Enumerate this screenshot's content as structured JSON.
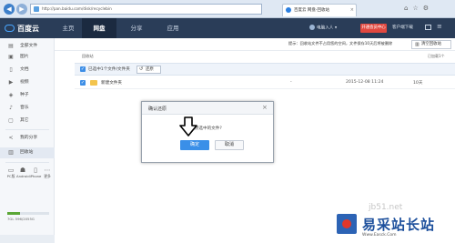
{
  "browser": {
    "url": "http://pan.baidu.com/disk/recyclebin",
    "tab_title": "百度云 网盘-回收站"
  },
  "header": {
    "logo": "百度云",
    "nav": [
      "主页",
      "网盘",
      "分享",
      "应用"
    ],
    "user": "电脑入人",
    "vip": "开通会员中心",
    "client": "客户端下载"
  },
  "sidebar": {
    "items": [
      {
        "label": "全部文件",
        "icon": "all-files-icon"
      },
      {
        "label": "图片",
        "icon": "image-icon"
      },
      {
        "label": "文档",
        "icon": "document-icon"
      },
      {
        "label": "视频",
        "icon": "video-icon"
      },
      {
        "label": "种子",
        "icon": "torrent-icon"
      },
      {
        "label": "音乐",
        "icon": "music-icon"
      },
      {
        "label": "其它",
        "icon": "other-icon"
      },
      {
        "label": "我的分享",
        "icon": "share-icon"
      },
      {
        "label": "回收站",
        "icon": "trash-icon"
      }
    ],
    "devices": [
      "PC版",
      "Android",
      "iPhone",
      "更多"
    ],
    "storage_text": "7GL 596/2055G",
    "storage_fraction": 0.3
  },
  "main": {
    "notice": "提示：回收站文件不占用您的空间，文件保存10天后将被删除",
    "clear_label": "清空回收站",
    "breadcrumb": "回收站",
    "loaded_text": "已加载1个",
    "selection_text": "已选中1个文件/文件夹",
    "restore_label": "还原",
    "file": {
      "name": "新建文件夹",
      "size": "-",
      "date": "2015-12-08 11:24",
      "days_left": "10天"
    }
  },
  "dialog": {
    "title": "确认还原",
    "close": "×",
    "message": "确认还原选中的文件?",
    "confirm": "确定",
    "cancel": "取消"
  },
  "watermark": {
    "url": "jb51.net",
    "brand": "易采站长站",
    "sub": "Www.Easck.Com"
  }
}
